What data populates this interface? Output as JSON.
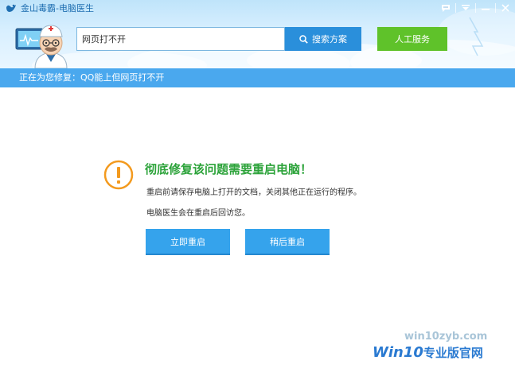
{
  "window": {
    "title": "金山毒霸-电脑医生"
  },
  "header": {
    "search_value": "网页打不开",
    "search_button_label": "搜索方案",
    "service_button_label": "人工服务"
  },
  "status": {
    "text": "正在为您修复：QQ能上但网页打不开"
  },
  "main": {
    "headline": "彻底修复该问题需要重启电脑！",
    "line1": "重启前请保存电脑上打开的文档，关闭其他正在运行的程序。",
    "line2": "电脑医生会在重启后回访您。",
    "restart_now_label": "立即重启",
    "restart_later_label": "稍后重启"
  },
  "watermark": {
    "url": "win10zyb.com",
    "brand_prefix": "Win10",
    "brand_suffix": "专业版官网"
  },
  "icons": {
    "app_logo": "kingsoft-logo-icon",
    "feedback": "chat-bubble-icon",
    "menu": "menu-icon",
    "minimize": "minimize-icon",
    "close": "close-icon",
    "search": "search-icon",
    "doctor": "doctor-avatar-icon",
    "warning": "warning-icon"
  },
  "colors": {
    "accent_blue": "#2a8fdb",
    "status_blue": "#4aa8ee",
    "green_button": "#5fc22a",
    "headline_green": "#2ca33a",
    "warning_orange": "#f39a1e",
    "action_button_blue": "#35a3ec"
  }
}
